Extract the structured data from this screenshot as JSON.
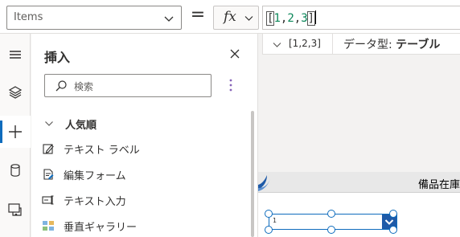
{
  "formula_bar": {
    "property": "Items",
    "equals": "=",
    "fx_label": "fx",
    "formula": {
      "open": "[",
      "v1": "1",
      "c1": ",",
      "v2": "2",
      "c2": ",",
      "v3": "3",
      "close": "]"
    }
  },
  "result": {
    "value": "[1,2,3]",
    "type_label": "データ型:",
    "type_value": "テーブル"
  },
  "rail": {
    "items": [
      "hamburger-icon",
      "layers-icon",
      "plus-icon",
      "database-icon",
      "media-icon"
    ]
  },
  "insert_panel": {
    "title": "挿入",
    "search_placeholder": "検索",
    "category": "人気順",
    "items": [
      {
        "label": "テキスト ラベル",
        "icon": "text-label-icon"
      },
      {
        "label": "編集フォーム",
        "icon": "edit-form-icon"
      },
      {
        "label": "テキスト入力",
        "icon": "text-input-icon"
      },
      {
        "label": "垂直ギャラリー",
        "icon": "gallery-icon"
      }
    ]
  },
  "canvas": {
    "header_text": "備品在庫",
    "dropdown_value": "1"
  },
  "colors": {
    "accent": "#0f6cbd",
    "number": "#098658",
    "dropdown_button": "#1e5aa8"
  }
}
